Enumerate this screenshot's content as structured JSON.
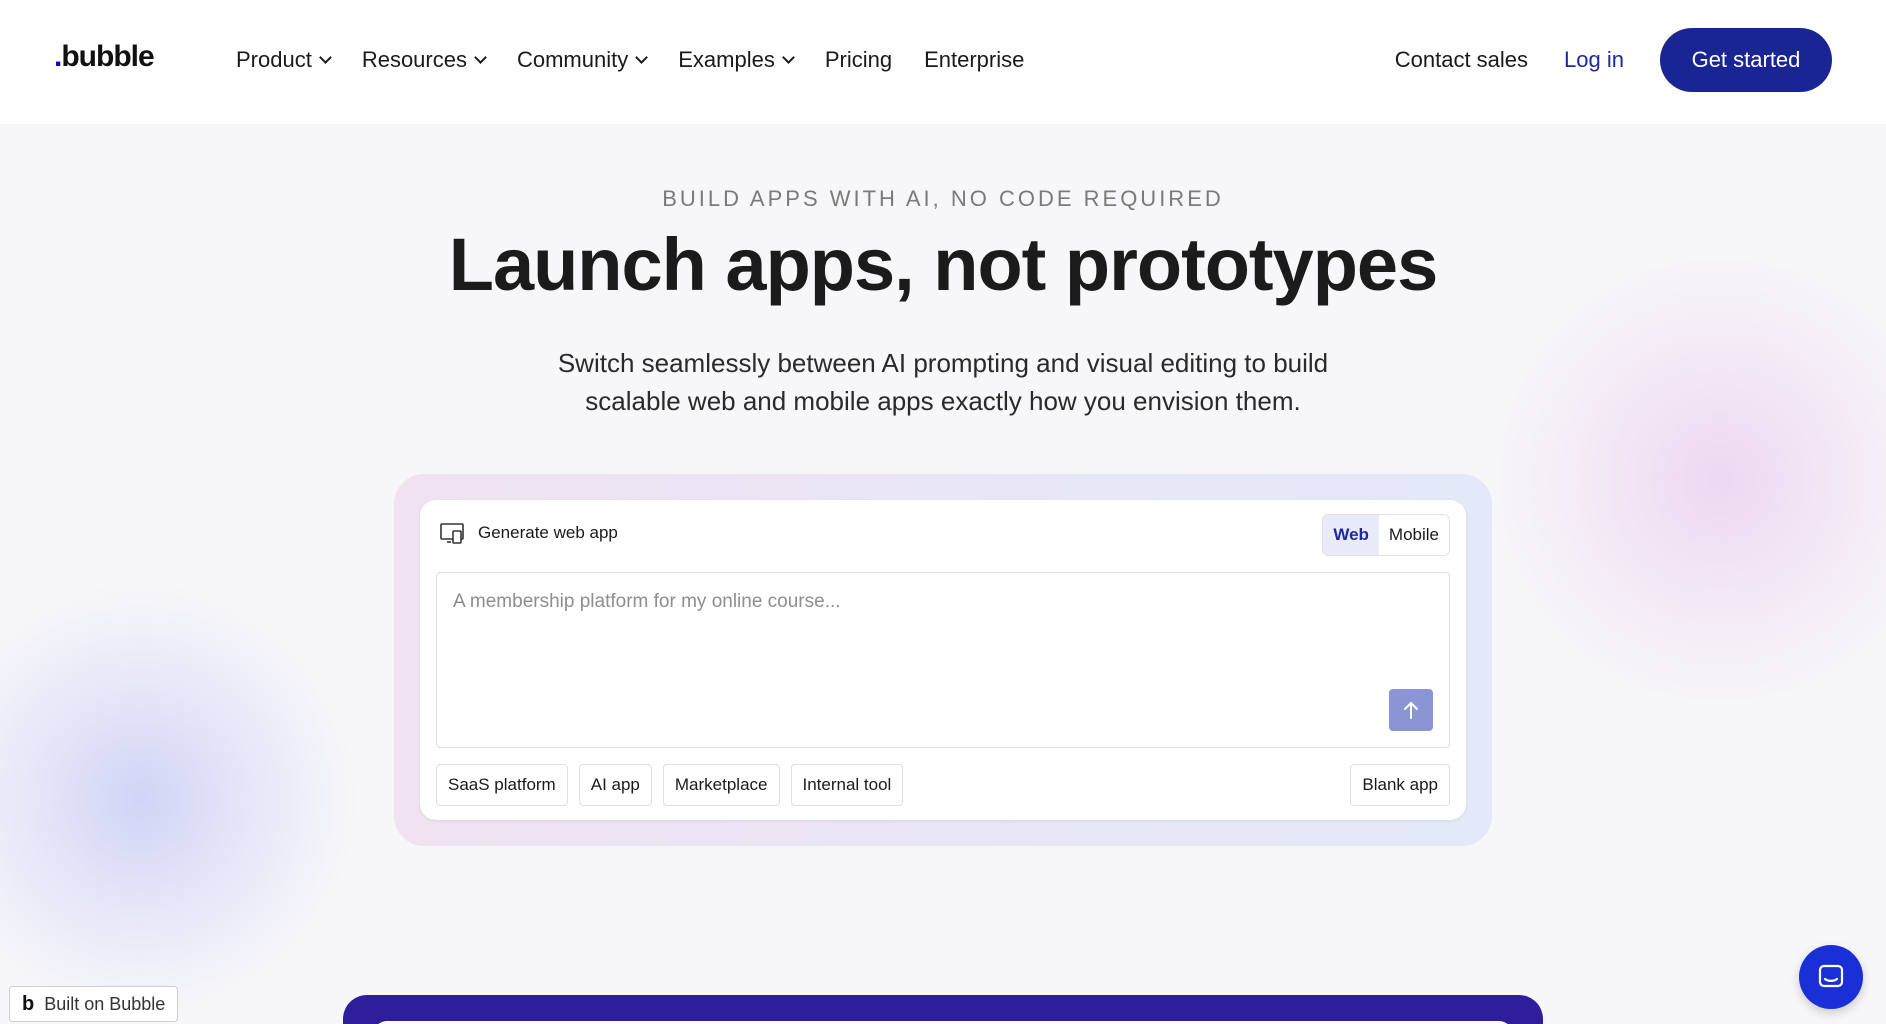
{
  "header": {
    "logo": ".bubble",
    "logo_dot": ".",
    "logo_word": "bubble",
    "nav": [
      {
        "label": "Product",
        "dropdown": true
      },
      {
        "label": "Resources",
        "dropdown": true
      },
      {
        "label": "Community",
        "dropdown": true
      },
      {
        "label": "Examples",
        "dropdown": true
      },
      {
        "label": "Pricing",
        "dropdown": false
      },
      {
        "label": "Enterprise",
        "dropdown": false
      }
    ],
    "contact_sales": "Contact sales",
    "login": "Log in",
    "get_started": "Get started"
  },
  "hero": {
    "eyebrow": "BUILD APPS WITH AI, NO CODE REQUIRED",
    "headline": "Launch apps, not prototypes",
    "subhead": "Switch seamlessly between AI prompting and visual editing to build scalable web and mobile apps exactly how you envision them."
  },
  "prompt_card": {
    "title": "Generate web app",
    "toggle": {
      "web": "Web",
      "mobile": "Mobile",
      "selected": "Web"
    },
    "placeholder": "A membership platform for my online course...",
    "chips": [
      "SaaS platform",
      "AI app",
      "Marketplace",
      "Internal tool"
    ],
    "blank_app": "Blank app"
  },
  "badge": {
    "mark": "b",
    "label": "Built on Bubble"
  },
  "colors": {
    "brand": "#1a2594",
    "login": "#1d2a9e",
    "send_button": "#8b95d6",
    "chat_launcher": "#1b2fd6",
    "bottom_panel": "#2e1e9c"
  },
  "icons": {
    "nav_dropdown": "chevron-down-icon",
    "generate": "device-monitor-icon",
    "send": "arrow-up-icon",
    "chat": "chat-icon"
  }
}
